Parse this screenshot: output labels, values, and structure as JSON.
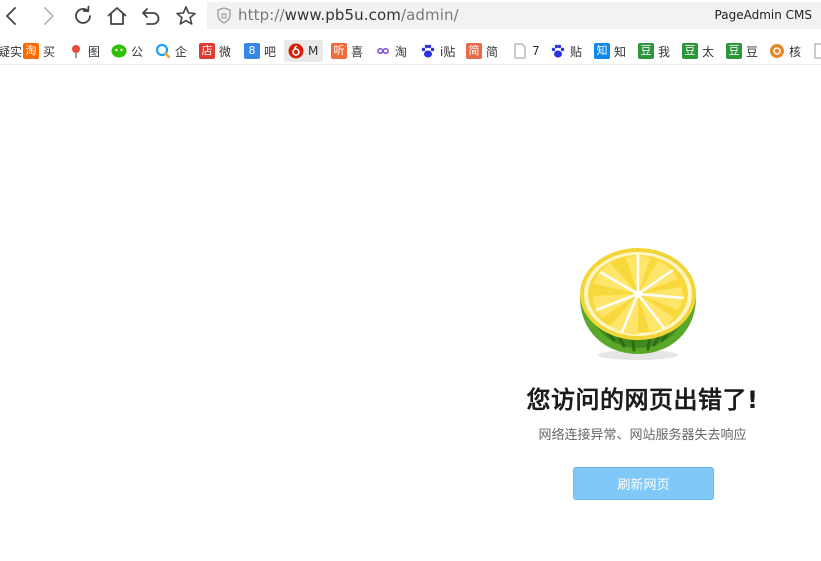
{
  "browser": {
    "nav": {
      "back_icon": "chevron-left-icon",
      "forward_icon": "chevron-right-icon",
      "reload_icon": "reload-icon",
      "home_icon": "home-icon",
      "undo_icon": "undo-icon",
      "favorite_icon": "star-icon"
    },
    "address": {
      "protocol": "http://",
      "host": "www.pb5u.com",
      "path": "/admin/",
      "security_icon": "shield-icon"
    },
    "tab_title": "PageAdmin CMS"
  },
  "bookmarks": [
    {
      "icon": "partial-icon",
      "label": "疑实",
      "icon_text": "",
      "color": "#888888"
    },
    {
      "icon": "taobao-icon",
      "label": "买",
      "icon_text": "淘",
      "color": "#ff6a00"
    },
    {
      "icon": "map-pin-icon",
      "label": "图",
      "icon_text": "",
      "color": "#e84a3a"
    },
    {
      "icon": "wechat-icon",
      "label": "公",
      "icon_text": "",
      "color": "#2dc100"
    },
    {
      "icon": "qq-search-icon",
      "label": "企",
      "icon_text": "",
      "color": "#1e9fff"
    },
    {
      "icon": "shop-icon",
      "label": "微",
      "icon_text": "店",
      "color": "#e23b33"
    },
    {
      "icon": "tieba-icon",
      "label": "吧",
      "icon_text": "8",
      "color": "#3487e2"
    },
    {
      "icon": "netease-music-icon",
      "label": "M",
      "icon_text": "",
      "color": "#d81e06"
    },
    {
      "icon": "ximalaya-icon",
      "label": "喜",
      "icon_text": "听",
      "color": "#f26b3a"
    },
    {
      "icon": "infinity-icon",
      "label": "淘",
      "icon_text": "",
      "color": "#7b4fd8"
    },
    {
      "icon": "baidu-paw-icon",
      "label": "i贴",
      "icon_text": "",
      "color": "#2932e1"
    },
    {
      "icon": "jianshu-icon",
      "label": "简",
      "icon_text": "简",
      "color": "#e8694b"
    },
    {
      "icon": "document-icon",
      "label": "7",
      "icon_text": "",
      "color": "#999999"
    },
    {
      "icon": "baidu-paw-icon",
      "label": "贴",
      "icon_text": "",
      "color": "#2932e1"
    },
    {
      "icon": "zhihu-icon",
      "label": "知",
      "icon_text": "知",
      "color": "#0f88eb"
    },
    {
      "icon": "douban-icon",
      "label": "我",
      "icon_text": "豆",
      "color": "#2e963d"
    },
    {
      "icon": "douban-icon",
      "label": "太",
      "icon_text": "豆",
      "color": "#2e963d"
    },
    {
      "icon": "douban-icon",
      "label": "豆",
      "icon_text": "豆",
      "color": "#2e963d"
    },
    {
      "icon": "orange-circle-icon",
      "label": "核",
      "icon_text": "",
      "color": "#e8862a"
    },
    {
      "icon": "document-icon",
      "label": "",
      "icon_text": "",
      "color": "#999999"
    }
  ],
  "error_page": {
    "logo_icon": "melon-logo-icon",
    "title": "您访问的网页出错了!",
    "subtitle": "网络连接异常、网站服务器失去响应",
    "refresh_label": "刷新网页"
  },
  "colors": {
    "button": "#80c8f8",
    "address_bg": "#f2f2f2"
  }
}
